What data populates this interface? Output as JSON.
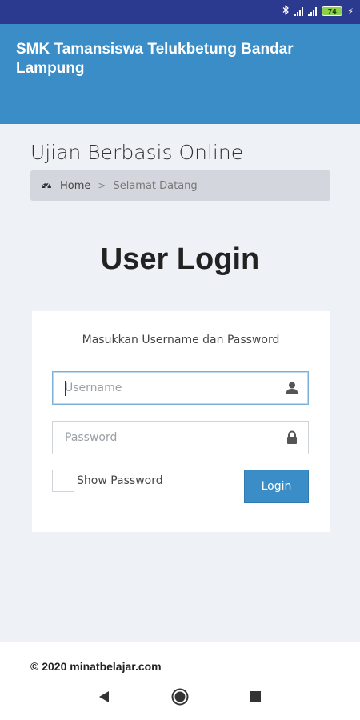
{
  "app": {
    "title": "SMK Tamansiswa Telukbetung Bandar Lampung"
  },
  "page": {
    "title": "Ujian Berbasis Online"
  },
  "breadcrumb": {
    "home": "Home",
    "separator": ">",
    "current": "Selamat Datang"
  },
  "login": {
    "heading": "User Login",
    "instruction": "Masukkan Username dan Password",
    "username_placeholder": "Username",
    "password_placeholder": "Password",
    "show_password_label": "Show Password",
    "button_label": "Login"
  },
  "footer": {
    "text": "© 2020 minatbelajar.com"
  },
  "status_bar": {
    "battery": "74"
  },
  "colors": {
    "header": "#3a8dc6",
    "status_bar": "#2b3a8f",
    "button": "#3a8dc6",
    "background": "#eef1f6"
  },
  "icons": [
    "bluetooth-icon",
    "signal-icon",
    "battery-icon",
    "dashboard-icon",
    "user-icon",
    "lock-icon",
    "back-icon",
    "home-icon",
    "recent-apps-icon"
  ]
}
